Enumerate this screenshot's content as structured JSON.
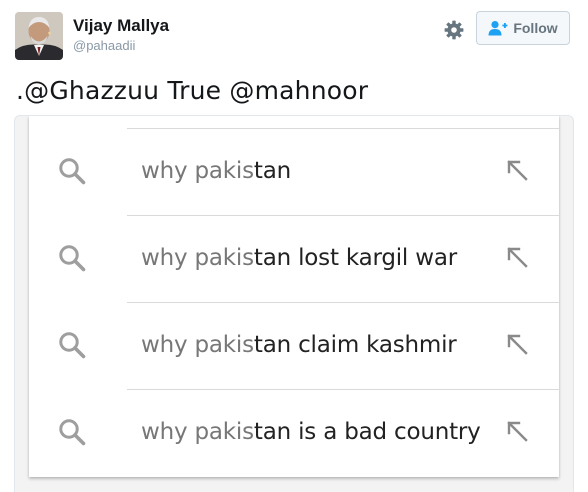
{
  "user": {
    "display_name": "Vijay Mallya",
    "handle": "@pahaadii"
  },
  "actions": {
    "follow_label": "Follow",
    "settings_icon": "gear-icon",
    "follow_icon": "add-user-icon"
  },
  "tweet": {
    "text": ".@Ghazzuu True @mahnoor"
  },
  "search_suggestions": {
    "typed_query": "why pakis",
    "items": [
      {
        "typed": "why pakis",
        "completion": "tan"
      },
      {
        "typed": "why pakis",
        "completion": "tan lost kargil war"
      },
      {
        "typed": "why pakis",
        "completion": "tan claim kashmir"
      },
      {
        "typed": "why pakis",
        "completion": "tan is a bad country"
      }
    ]
  },
  "colors": {
    "accent": "#1da1f2",
    "text_primary": "#14171a",
    "text_secondary": "#8899a6",
    "suggestion_typed": "#777777",
    "suggestion_completion": "#222222"
  }
}
